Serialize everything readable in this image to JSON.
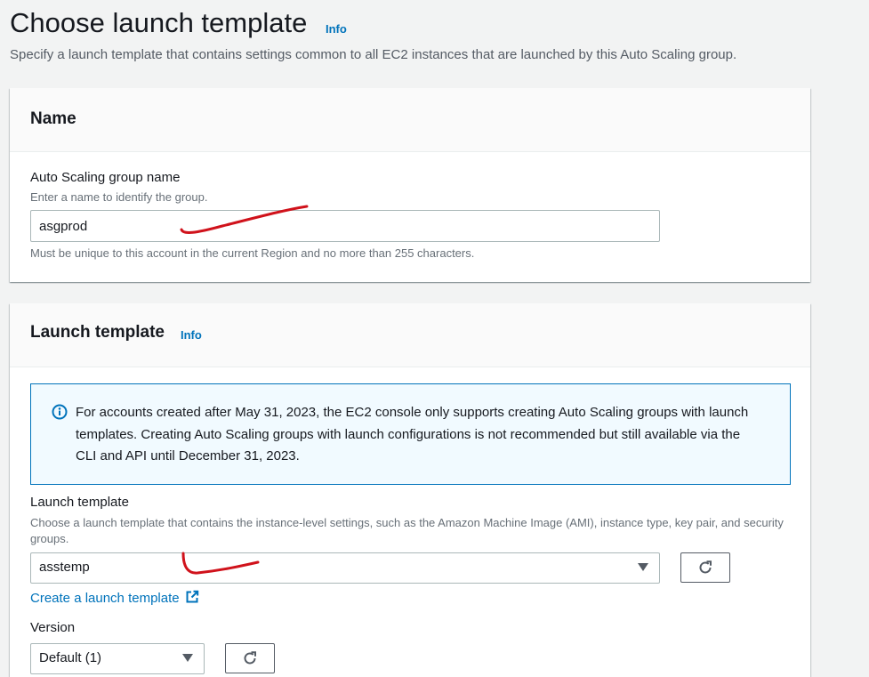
{
  "header": {
    "title": "Choose launch template",
    "info_label": "Info",
    "description": "Specify a launch template that contains settings common to all EC2 instances that are launched by this Auto Scaling group."
  },
  "name_panel": {
    "title": "Name",
    "asg_label": "Auto Scaling group name",
    "asg_description": "Enter a name to identify the group.",
    "asg_value": "asgprod",
    "asg_constraint": "Must be unique to this account in the current Region and no more than 255 characters."
  },
  "launch_panel": {
    "title": "Launch template",
    "info_label": "Info",
    "alert_text": "For accounts created after May 31, 2023, the EC2 console only supports creating Auto Scaling groups with launch templates. Creating Auto Scaling groups with launch configurations is not recommended but still available via the CLI and API until December 31, 2023.",
    "template_label": "Launch template",
    "template_description": "Choose a launch template that contains the instance-level settings, such as the Amazon Machine Image (AMI), instance type, key pair, and security groups.",
    "template_selected": "asstemp",
    "create_link": "Create a launch template",
    "version_label": "Version",
    "version_selected": "Default (1)"
  },
  "colors": {
    "accent": "#0073bb",
    "annotation": "#d0121b"
  },
  "icons": [
    "info-circle-icon",
    "refresh-icon",
    "external-link-icon",
    "caret-down-icon"
  ]
}
